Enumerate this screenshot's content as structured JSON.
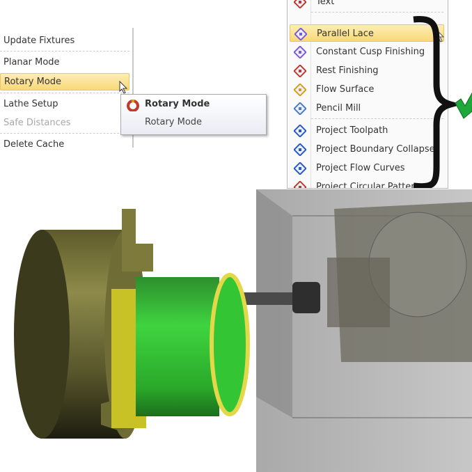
{
  "left_menu": {
    "items": [
      {
        "label": "Update Fixtures",
        "state": "normal"
      },
      {
        "label": "Planar Mode",
        "state": "normal"
      },
      {
        "label": "Rotary Mode",
        "state": "highlighted"
      },
      {
        "label": "Lathe Setup",
        "state": "normal"
      },
      {
        "label": "Safe Distances",
        "state": "disabled"
      },
      {
        "label": "Delete Cache",
        "state": "normal"
      }
    ]
  },
  "tooltip": {
    "title": "Rotary Mode",
    "description": "Rotary Mode",
    "icon": "rotary-mode-icon"
  },
  "right_menu": {
    "items": [
      {
        "label": "Text",
        "icon": "text-icon"
      },
      {
        "label": "Parallel Lace",
        "icon": "parallel-lace-icon",
        "highlighted": true
      },
      {
        "label": "Constant Cusp Finishing",
        "icon": "constant-cusp-icon"
      },
      {
        "label": "Rest Finishing",
        "icon": "rest-finishing-icon"
      },
      {
        "label": "Flow Surface",
        "icon": "flow-surface-icon"
      },
      {
        "label": "Pencil Mill",
        "icon": "pencil-mill-icon"
      },
      {
        "label": "Project Toolpath",
        "icon": "project-toolpath-icon"
      },
      {
        "label": "Project Boundary Collapse",
        "icon": "project-boundary-collapse-icon"
      },
      {
        "label": "Project Flow Curves",
        "icon": "project-flow-curves-icon"
      },
      {
        "label": "Project Circular Pattern",
        "icon": "project-circular-pattern-icon"
      }
    ]
  },
  "annotation": {
    "brace_color": "#111111",
    "checkmark_color": "#1fa83a"
  },
  "colors": {
    "highlight": "#f8d978",
    "part": "#2fbf2f",
    "fixture": "#6b6830"
  }
}
